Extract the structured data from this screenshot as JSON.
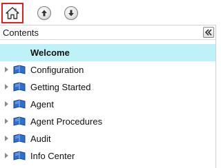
{
  "toolbar": {
    "home_icon": "home-icon",
    "up_icon": "arrow-up-icon",
    "down_icon": "arrow-down-icon",
    "home_highlight_color": "#e0201f"
  },
  "contents": {
    "title": "Contents",
    "collapse_icon": "double-chevron-left-icon"
  },
  "tree": {
    "selected_color": "#bff1f8",
    "welcome": "Welcome",
    "items": [
      {
        "label": "Configuration",
        "icon": "book-icon"
      },
      {
        "label": "Getting Started",
        "icon": "book-icon"
      },
      {
        "label": "Agent",
        "icon": "book-icon"
      },
      {
        "label": "Agent Procedures",
        "icon": "book-icon"
      },
      {
        "label": "Audit",
        "icon": "book-icon"
      },
      {
        "label": "Info Center",
        "icon": "book-icon"
      }
    ]
  }
}
